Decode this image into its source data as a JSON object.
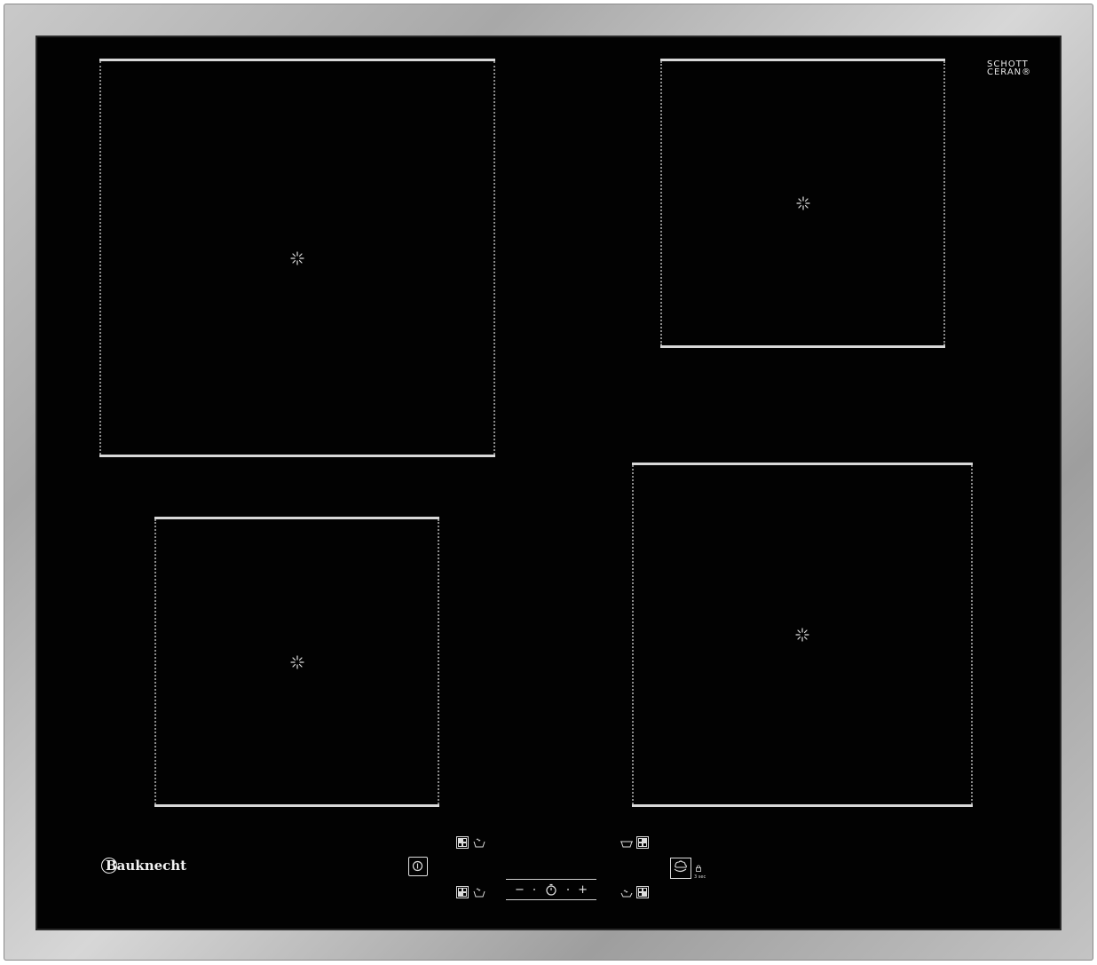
{
  "brand": {
    "glass_maker_line1": "SCHOTT",
    "glass_maker_line2": "CERAN®",
    "logo_text": "Bauknecht"
  },
  "zones": [
    {
      "id": "front-left-large",
      "label": "cooking zone rear left"
    },
    {
      "id": "rear-right",
      "label": "cooking zone rear right"
    },
    {
      "id": "front-left",
      "label": "cooking zone front left"
    },
    {
      "id": "front-right",
      "label": "cooking zone front right"
    }
  ],
  "controls": {
    "timer_minus": "−",
    "timer_plus": "+",
    "booster_caption": "3 sec"
  },
  "colors": {
    "glass": "#020202",
    "frame": "#b8b8b8",
    "zone_edge": "#d8d8d8"
  }
}
